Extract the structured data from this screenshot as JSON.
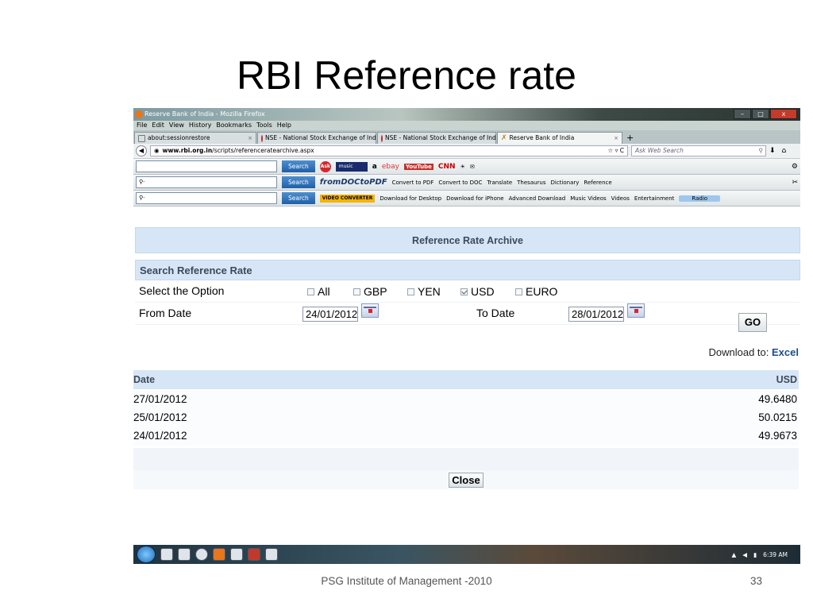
{
  "slide": {
    "title": "RBI Reference rate",
    "footer": "PSG Institute of Management -2010",
    "page_number": "33"
  },
  "browser": {
    "window_title": "Reserve Bank of India - Mozilla Firefox",
    "menu": [
      "File",
      "Edit",
      "View",
      "History",
      "Bookmarks",
      "Tools",
      "Help"
    ],
    "tabs": [
      {
        "label": "about:sessionrestore",
        "icon": "blank-page-icon",
        "active": false
      },
      {
        "label": "NSE - National Stock Exchange of Ind...",
        "icon": "nse-icon",
        "active": false
      },
      {
        "label": "NSE - National Stock Exchange of Ind...",
        "icon": "nse-icon",
        "active": false
      },
      {
        "label": "Reserve Bank of India",
        "icon": "rbi-icon",
        "active": true
      }
    ],
    "url_domain": "www.rbi.org.in",
    "url_path": "/scripts/referenceratearchive.aspx",
    "web_search_placeholder": "Ask Web Search",
    "toolbar1": {
      "search_label": "Search",
      "music_label": "music",
      "brands": [
        "a",
        "ebay",
        "YouTube",
        "CNN"
      ]
    },
    "toolbar2": {
      "search_label": "Search",
      "items": [
        "fromDOCtoPDF",
        "Convert to PDF",
        "Convert to DOC",
        "Translate",
        "Thesaurus",
        "Dictionary",
        "Reference"
      ]
    },
    "toolbar3": {
      "search_label": "Search",
      "items": [
        "VIDEO CONVERTER",
        "Download for Desktop",
        "Download for iPhone",
        "Advanced Download",
        "Music Videos",
        "Videos",
        "Entertainment",
        "Radio"
      ]
    }
  },
  "archive": {
    "header": "Reference Rate Archive",
    "search_header": "Search Reference Rate",
    "select_label": "Select the Option",
    "options": [
      {
        "label": "All",
        "checked": false
      },
      {
        "label": "GBP",
        "checked": false
      },
      {
        "label": "YEN",
        "checked": false
      },
      {
        "label": "USD",
        "checked": true
      },
      {
        "label": "EURO",
        "checked": false
      }
    ],
    "from_label": "From Date",
    "from_value": "24/01/2012",
    "to_label": "To Date",
    "to_value": "28/01/2012",
    "go_label": "GO",
    "download_label": "Download to:",
    "download_link": "Excel",
    "col_date": "Date",
    "col_usd": "USD",
    "rows": [
      {
        "date": "27/01/2012",
        "usd": "49.6480"
      },
      {
        "date": "25/01/2012",
        "usd": "50.0215"
      },
      {
        "date": "24/01/2012",
        "usd": "49.9673"
      }
    ],
    "close_label": "Close"
  },
  "taskbar": {
    "time": "6:39 AM"
  }
}
